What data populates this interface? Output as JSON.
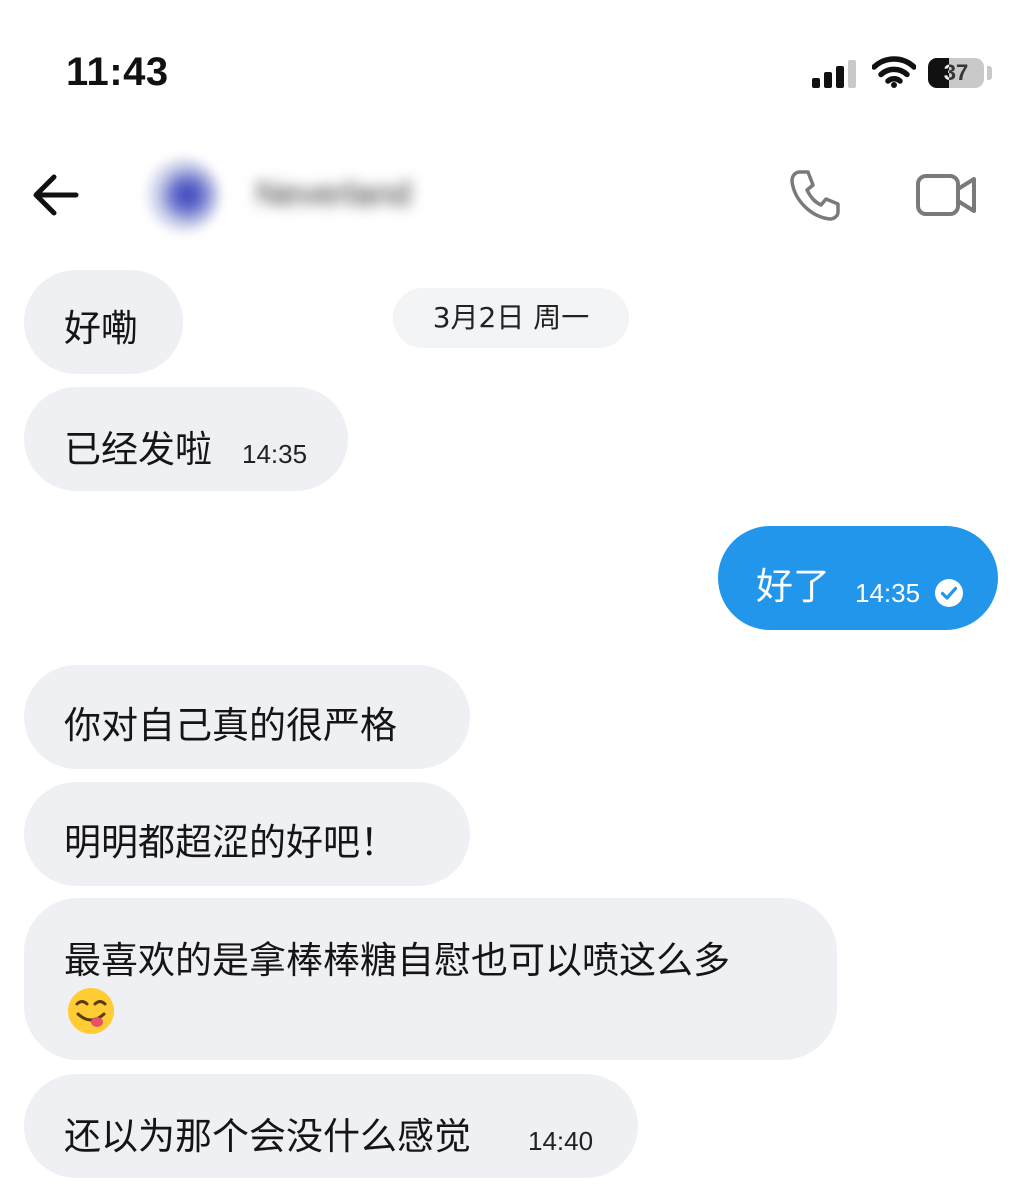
{
  "status_bar": {
    "time": "11:43",
    "battery_level": 37,
    "battery_text": "37"
  },
  "header": {
    "contact_name": "Neverland",
    "icons": [
      "back-arrow-icon",
      "phone-icon",
      "video-camera-icon"
    ]
  },
  "date_separator": "3月2日 周一",
  "messages": [
    {
      "direction": "incoming",
      "text": "好嘞",
      "time": ""
    },
    {
      "direction": "incoming",
      "text": "已经发啦",
      "time": "14:35"
    },
    {
      "direction": "outgoing",
      "text": "好了",
      "time": "14:35",
      "status_icon": "read-check-icon"
    },
    {
      "direction": "incoming",
      "text": "你对自己真的很严格",
      "time": ""
    },
    {
      "direction": "incoming",
      "text": "明明都超涩的好吧！",
      "time": ""
    },
    {
      "direction": "incoming",
      "text": "最喜欢的是拿棒棒糖自慰也可以喷这么多",
      "emoji": "😋",
      "time": ""
    },
    {
      "direction": "incoming",
      "text": "还以为那个会没什么感觉",
      "time": "14:40"
    }
  ],
  "colors": {
    "incoming_bubble": "#eef0f3",
    "outgoing_bubble": "#2196eb",
    "background": "#ffffff"
  }
}
